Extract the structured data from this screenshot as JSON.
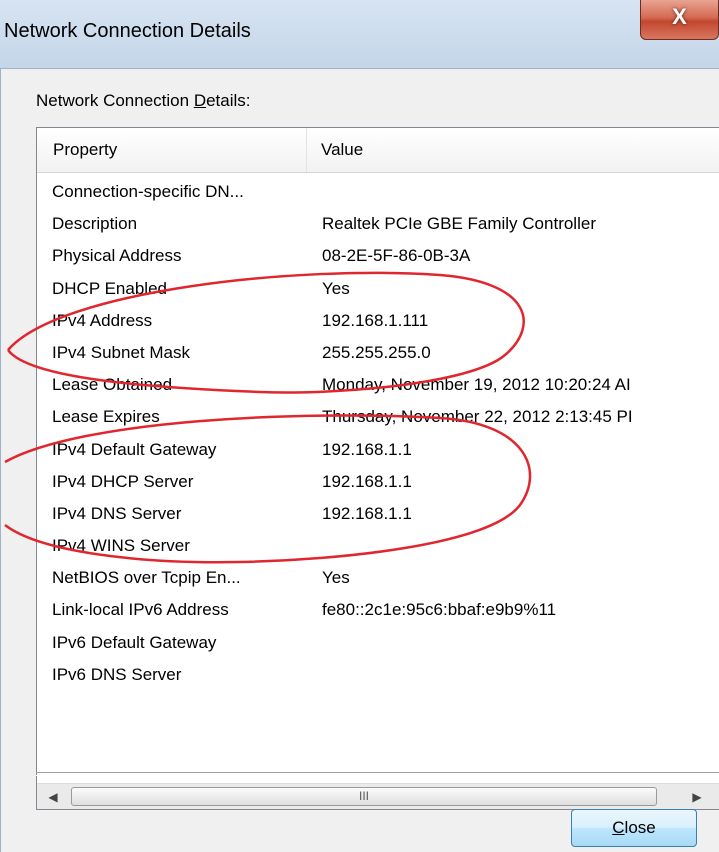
{
  "window": {
    "title": "Network Connection Details",
    "close_glyph": "X"
  },
  "group": {
    "label_prefix": "Network Connection ",
    "label_underlined": "D",
    "label_suffix": "etails:"
  },
  "table": {
    "headers": {
      "property": "Property",
      "value": "Value"
    },
    "rows": [
      {
        "property": "Connection-specific DN...",
        "value": ""
      },
      {
        "property": "Description",
        "value": "Realtek PCIe GBE Family Controller"
      },
      {
        "property": "Physical Address",
        "value": "08-2E-5F-86-0B-3A"
      },
      {
        "property": "DHCP Enabled",
        "value": "Yes"
      },
      {
        "property": "IPv4 Address",
        "value": "192.168.1.111"
      },
      {
        "property": "IPv4 Subnet Mask",
        "value": "255.255.255.0"
      },
      {
        "property": "Lease Obtained",
        "value": "Monday, November 19, 2012 10:20:24 AI"
      },
      {
        "property": "Lease Expires",
        "value": "Thursday, November 22, 2012 2:13:45 PI"
      },
      {
        "property": "IPv4 Default Gateway",
        "value": "192.168.1.1"
      },
      {
        "property": "IPv4 DHCP Server",
        "value": "192.168.1.1"
      },
      {
        "property": "IPv4 DNS Server",
        "value": "192.168.1.1"
      },
      {
        "property": "IPv4 WINS Server",
        "value": ""
      },
      {
        "property": "NetBIOS over Tcpip En...",
        "value": "Yes"
      },
      {
        "property": "Link-local IPv6 Address",
        "value": "fe80::2c1e:95c6:bbaf:e9b9%11"
      },
      {
        "property": "IPv6 Default Gateway",
        "value": ""
      },
      {
        "property": "IPv6 DNS Server",
        "value": ""
      }
    ]
  },
  "scrollbar": {
    "left_arrow": "◀",
    "right_arrow": "▶",
    "thumb_grip": "III"
  },
  "buttons": {
    "close_underlined": "C",
    "close_rest": "lose"
  },
  "colors": {
    "annotation_red": "#e0262e",
    "button_border": "#3c7fb1"
  }
}
